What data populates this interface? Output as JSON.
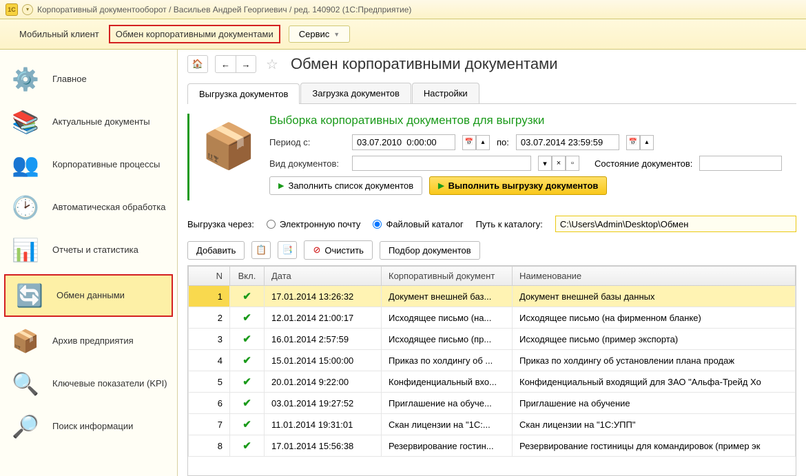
{
  "titlebar": {
    "text": "Корпоративный документооборот / Васильев Андрей Георгиевич / ред. 140902 (1С:Предприятие)"
  },
  "menubar": {
    "mobile": "Мобильный клиент",
    "exchange": "Обмен корпоративными документами",
    "service": "Сервис"
  },
  "sidebar": {
    "items": [
      {
        "label": "Главное",
        "icon": "⚙️"
      },
      {
        "label": "Актуальные документы",
        "icon": "📚"
      },
      {
        "label": "Корпоративные процессы",
        "icon": "👥"
      },
      {
        "label": "Автоматическая обработка",
        "icon": "🕑"
      },
      {
        "label": "Отчеты и статистика",
        "icon": "📊"
      },
      {
        "label": "Обмен данными",
        "icon": "🔄"
      },
      {
        "label": "Архив предприятия",
        "icon": "📦"
      },
      {
        "label": "Ключевые показатели (KPI)",
        "icon": "🔍"
      },
      {
        "label": "Поиск информации",
        "icon": "🔎"
      }
    ]
  },
  "page": {
    "title": "Обмен корпоративными документами"
  },
  "tabs": {
    "upload": "Выгрузка документов",
    "download": "Загрузка документов",
    "settings": "Настройки"
  },
  "filter": {
    "title": "Выборка корпоративных документов для выгрузки",
    "period_from_label": "Период с:",
    "period_from": "03.07.2010  0:00:00",
    "period_to_label": "по:",
    "period_to": "03.07.2014 23:59:59",
    "doc_type_label": "Вид документов:",
    "doc_state_label": "Состояние документов:",
    "fill_btn": "Заполнить список документов",
    "export_btn": "Выполнить выгрузку документов"
  },
  "exportrow": {
    "via_label": "Выгрузка через:",
    "email_label": "Электронную почту",
    "file_label": "Файловый каталог",
    "path_label": "Путь к каталогу:",
    "path_value": "C:\\Users\\Admin\\Desktop\\Обмен"
  },
  "toolbar2": {
    "add": "Добавить",
    "clear": "Очистить",
    "select": "Подбор документов"
  },
  "table": {
    "headers": {
      "n": "N",
      "chk": "Вкл.",
      "date": "Дата",
      "doc": "Корпоративный документ",
      "name": "Наименование"
    },
    "rows": [
      {
        "n": "1",
        "date": "17.01.2014 13:26:32",
        "doc": "Документ внешней баз...",
        "name": "Документ внешней базы данных"
      },
      {
        "n": "2",
        "date": "12.01.2014 21:00:17",
        "doc": "Исходящее письмо (на...",
        "name": "Исходящее письмо (на фирменном бланке)"
      },
      {
        "n": "3",
        "date": "16.01.2014 2:57:59",
        "doc": "Исходящее письмо (пр...",
        "name": "Исходящее письмо (пример экспорта)"
      },
      {
        "n": "4",
        "date": "15.01.2014 15:00:00",
        "doc": "Приказ по холдингу об ...",
        "name": "Приказ по холдингу об установлении плана продаж"
      },
      {
        "n": "5",
        "date": "20.01.2014 9:22:00",
        "doc": "Конфиденциальный вхо...",
        "name": "Конфиденциальный входящий для ЗАО \"Альфа-Трейд Хо"
      },
      {
        "n": "6",
        "date": "03.01.2014 19:27:52",
        "doc": "Приглашение на обуче...",
        "name": "Приглашение на обучение"
      },
      {
        "n": "7",
        "date": "11.01.2014 19:31:01",
        "doc": "Скан лицензии на \"1С:...",
        "name": "Скан лицензии на \"1С:УПП\""
      },
      {
        "n": "8",
        "date": "17.01.2014 15:56:38",
        "doc": "Резервирование гостин...",
        "name": "Резервирование гостиницы для командировок  (пример эк"
      }
    ]
  }
}
